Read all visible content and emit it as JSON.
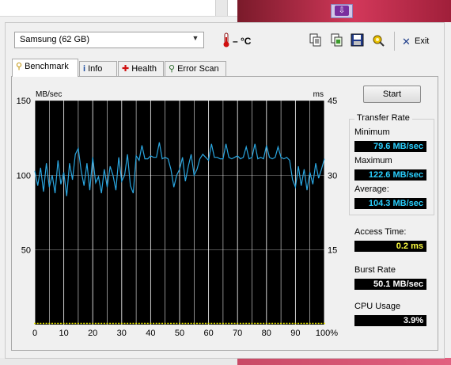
{
  "toolbar": {
    "drive": "Samsung (62 GB)",
    "temperature": "– °C",
    "exit_label": "Exit"
  },
  "tabs": [
    {
      "label": "Benchmark"
    },
    {
      "label": "Info"
    },
    {
      "label": "Health"
    },
    {
      "label": "Error Scan"
    }
  ],
  "benchmark": {
    "start_label": "Start",
    "transfer_rate_title": "Transfer Rate",
    "minimum_label": "Minimum",
    "minimum_value": "79.6 MB/sec",
    "maximum_label": "Maximum",
    "maximum_value": "122.6 MB/sec",
    "average_label": "Average:",
    "average_value": "104.3 MB/sec",
    "access_label": "Access Time:",
    "access_value": "0.2 ms",
    "burst_label": "Burst Rate",
    "burst_value": "50.1 MB/sec",
    "cpu_label": "CPU Usage",
    "cpu_value": "3.9%"
  },
  "colors": {
    "transfer_line": "#2aa6e0",
    "access_points": "#e8e800",
    "grid": "#ffffff",
    "plot_bg": "#000000"
  },
  "chart_data": {
    "type": "line",
    "ylabel_left": "MB/sec",
    "ylabel_right": "ms",
    "y_left_ticks": [
      "150",
      "100",
      "50"
    ],
    "y_right_ticks": [
      "45",
      "30",
      "15"
    ],
    "x_ticks": [
      "0",
      "10",
      "20",
      "30",
      "40",
      "50",
      "60",
      "70",
      "80",
      "90",
      "100%"
    ],
    "ylim_left": [
      0,
      150
    ],
    "ylim_right": [
      0,
      45
    ],
    "xlim": [
      0,
      100
    ],
    "series": [
      {
        "name": "Transfer Rate",
        "x": [
          0,
          1,
          2,
          3,
          4,
          5,
          6,
          7,
          8,
          9,
          10,
          11,
          12,
          13,
          14,
          15,
          16,
          17,
          18,
          19,
          20,
          21,
          22,
          23,
          24,
          25,
          26,
          27,
          28,
          29,
          30,
          31,
          32,
          33,
          34,
          35,
          36,
          37,
          38,
          39,
          40,
          41,
          42,
          43,
          44,
          45,
          46,
          47,
          48,
          49,
          50,
          51,
          52,
          53,
          54,
          55,
          56,
          57,
          58,
          59,
          60,
          61,
          62,
          63,
          64,
          65,
          66,
          67,
          68,
          69,
          70,
          71,
          72,
          73,
          74,
          75,
          76,
          77,
          78,
          79,
          80,
          81,
          82,
          83,
          84,
          85,
          86,
          87,
          88,
          89,
          90,
          91,
          92,
          93,
          94,
          95,
          96,
          97,
          98,
          99,
          100
        ],
        "y": [
          103,
          93,
          105,
          89,
          108,
          92,
          100,
          88,
          110,
          94,
          102,
          86,
          108,
          97,
          114,
          118,
          103,
          93,
          108,
          90,
          112,
          95,
          99,
          88,
          104,
          92,
          106,
          100,
          90,
          112,
          96,
          100,
          114,
          93,
          88,
          113,
          110,
          120,
          111,
          111,
          113,
          112,
          112,
          122,
          111,
          112,
          111,
          104,
          92,
          100,
          104,
          112,
          96,
          106,
          114,
          100,
          104,
          111,
          114,
          112,
          110,
          121,
          112,
          112,
          111,
          111,
          121,
          112,
          111,
          112,
          113,
          111,
          112,
          119,
          111,
          112,
          121,
          111,
          112,
          111,
          120,
          112,
          111,
          112,
          119,
          112,
          111,
          112,
          110,
          97,
          92,
          106,
          93,
          104,
          90,
          102,
          94,
          108,
          98,
          104,
          111
        ]
      }
    ],
    "access_points_ms": 0.2
  }
}
